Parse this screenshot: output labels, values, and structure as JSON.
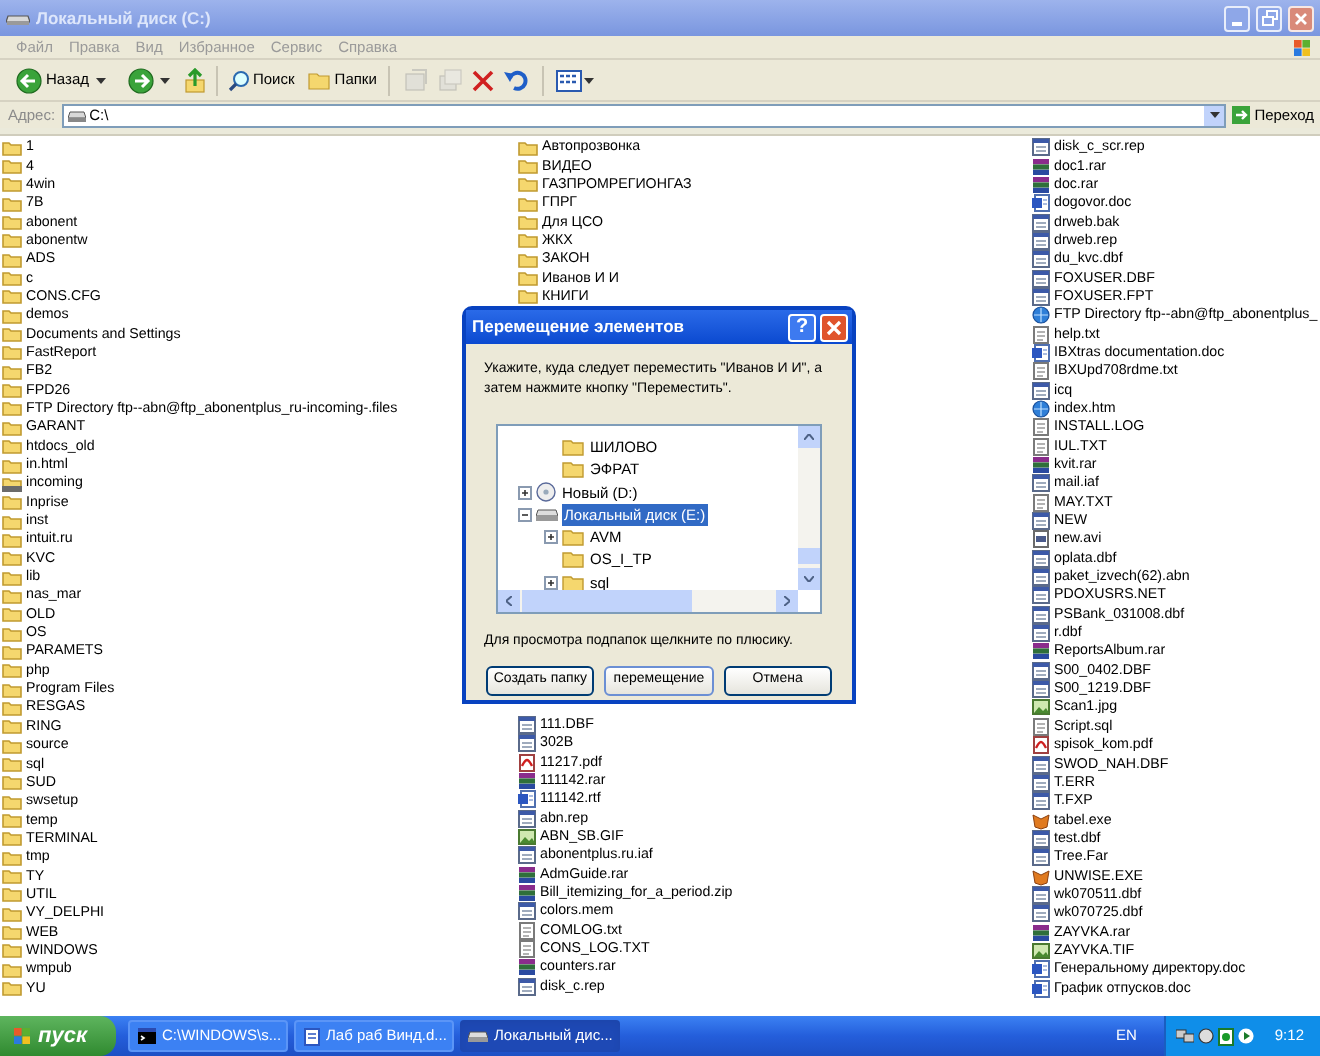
{
  "window": {
    "title": "Локальный диск (C:)"
  },
  "menu": [
    "Файл",
    "Правка",
    "Вид",
    "Избранное",
    "Сервис",
    "Справка"
  ],
  "toolbar": {
    "back_label": "Назад",
    "search_label": "Поиск",
    "folders_label": "Папки",
    "tools": [
      {
        "kind": "move",
        "disabled": true
      },
      {
        "kind": "copy",
        "disabled": true
      },
      {
        "kind": "delete",
        "disabled": false
      },
      {
        "kind": "undo",
        "disabled": false
      }
    ]
  },
  "address": {
    "label": "Адрес:",
    "value": "C:\\",
    "go_label": "Переход"
  },
  "file_columns": [
    {
      "items": [
        {
          "name": "1",
          "kind": "folder"
        },
        {
          "name": "4",
          "kind": "folder"
        },
        {
          "name": "4win",
          "kind": "folder"
        },
        {
          "name": "7B",
          "kind": "folder"
        },
        {
          "name": "abonent",
          "kind": "folder"
        },
        {
          "name": "abonentw",
          "kind": "folder"
        },
        {
          "name": "ADS",
          "kind": "folder"
        },
        {
          "name": "c",
          "kind": "folder"
        },
        {
          "name": "CONS.CFG",
          "kind": "folder"
        },
        {
          "name": "demos",
          "kind": "folder"
        },
        {
          "name": "Documents and Settings",
          "kind": "folder"
        },
        {
          "name": "FastReport",
          "kind": "folder"
        },
        {
          "name": "FB2",
          "kind": "folder"
        },
        {
          "name": "FPD26",
          "kind": "folder"
        },
        {
          "name": "FTP Directory ftp--abn@ftp_abonentplus_ru-incoming-.files",
          "kind": "folder"
        },
        {
          "name": "GARANT",
          "kind": "folder"
        },
        {
          "name": "htdocs_old",
          "kind": "folder"
        },
        {
          "name": "in.html",
          "kind": "folder"
        },
        {
          "name": "incoming",
          "kind": "shared"
        },
        {
          "name": "Inprise",
          "kind": "folder"
        },
        {
          "name": "inst",
          "kind": "folder"
        },
        {
          "name": "intuit.ru",
          "kind": "folder"
        },
        {
          "name": "KVC",
          "kind": "folder"
        },
        {
          "name": "lib",
          "kind": "folder"
        },
        {
          "name": "nas_mar",
          "kind": "folder"
        },
        {
          "name": "OLD",
          "kind": "folder"
        },
        {
          "name": "OS",
          "kind": "folder"
        },
        {
          "name": "PARAMETS",
          "kind": "folder"
        },
        {
          "name": "php",
          "kind": "folder"
        },
        {
          "name": "Program Files",
          "kind": "folder"
        },
        {
          "name": "RESGAS",
          "kind": "folder"
        },
        {
          "name": "RING",
          "kind": "folder"
        },
        {
          "name": "source",
          "kind": "folder"
        },
        {
          "name": "sql",
          "kind": "folder"
        },
        {
          "name": "SUD",
          "kind": "folder"
        },
        {
          "name": "swsetup",
          "kind": "folder"
        },
        {
          "name": "temp",
          "kind": "folder"
        },
        {
          "name": "TERMINAL",
          "kind": "folder"
        },
        {
          "name": "tmp",
          "kind": "folder"
        },
        {
          "name": "TY",
          "kind": "folder"
        },
        {
          "name": "UTIL",
          "kind": "folder"
        },
        {
          "name": "VY_DELPHI",
          "kind": "folder"
        },
        {
          "name": "WEB",
          "kind": "folder"
        },
        {
          "name": "WINDOWS",
          "kind": "folder"
        },
        {
          "name": "wmpub",
          "kind": "folder"
        },
        {
          "name": "YU",
          "kind": "folder"
        }
      ]
    },
    {
      "items": [
        {
          "name": "Автопрозвонка",
          "kind": "folder"
        },
        {
          "name": "ВИДЕО",
          "kind": "folder"
        },
        {
          "name": "ГАЗПРОМРЕГИОНГАЗ",
          "kind": "folder"
        },
        {
          "name": "ГПРГ",
          "kind": "folder"
        },
        {
          "name": "Для ЦСО",
          "kind": "folder"
        },
        {
          "name": "ЖКХ",
          "kind": "folder"
        },
        {
          "name": "ЗАКОН",
          "kind": "folder"
        },
        {
          "name": "Иванов И И",
          "kind": "folder"
        },
        {
          "name": "КНИГИ",
          "kind": "folder"
        }
      ],
      "items_after_dialog": [
        {
          "name": "111.DBF",
          "kind": "file"
        },
        {
          "name": "302B",
          "kind": "file"
        },
        {
          "name": "11217.pdf",
          "kind": "pdf"
        },
        {
          "name": "111142.rar",
          "kind": "rar"
        },
        {
          "name": "111142.rtf",
          "kind": "doc"
        },
        {
          "name": "abn.rep",
          "kind": "file"
        },
        {
          "name": "ABN_SB.GIF",
          "kind": "image"
        },
        {
          "name": "abonentplus.ru.iaf",
          "kind": "file"
        },
        {
          "name": "AdmGuide.rar",
          "kind": "rar"
        },
        {
          "name": "Bill_itemizing_for_a_period.zip",
          "kind": "rar"
        },
        {
          "name": "colors.mem",
          "kind": "file"
        },
        {
          "name": "COMLOG.txt",
          "kind": "text"
        },
        {
          "name": "CONS_LOG.TXT",
          "kind": "text"
        },
        {
          "name": "counters.rar",
          "kind": "rar"
        },
        {
          "name": "disk_c.rep",
          "kind": "file"
        }
      ]
    },
    {
      "items": [
        {
          "name": "disk_c_scr.rep",
          "kind": "file"
        },
        {
          "name": "doc1.rar",
          "kind": "rar"
        },
        {
          "name": "doc.rar",
          "kind": "rar"
        },
        {
          "name": "dogovor.doc",
          "kind": "doc"
        },
        {
          "name": "drweb.bak",
          "kind": "file"
        },
        {
          "name": "drweb.rep",
          "kind": "file"
        },
        {
          "name": "du_kvc.dbf",
          "kind": "file"
        },
        {
          "name": "FOXUSER.DBF",
          "kind": "file"
        },
        {
          "name": "FOXUSER.FPT",
          "kind": "file"
        },
        {
          "name": "FTP Directory ftp--abn@ftp_abonentplus_",
          "kind": "web"
        },
        {
          "name": "help.txt",
          "kind": "text"
        },
        {
          "name": "IBXtras documentation.doc",
          "kind": "doc"
        },
        {
          "name": "IBXUpd708rdme.txt",
          "kind": "text"
        },
        {
          "name": "icq",
          "kind": "file"
        },
        {
          "name": "index.htm",
          "kind": "web"
        },
        {
          "name": "INSTALL.LOG",
          "kind": "text"
        },
        {
          "name": "IUL.TXT",
          "kind": "text"
        },
        {
          "name": "kvit.rar",
          "kind": "rar"
        },
        {
          "name": "mail.iaf",
          "kind": "file"
        },
        {
          "name": "MAY.TXT",
          "kind": "text"
        },
        {
          "name": "NEW",
          "kind": "file"
        },
        {
          "name": "new.avi",
          "kind": "video"
        },
        {
          "name": "oplata.dbf",
          "kind": "file"
        },
        {
          "name": "paket_izvech(62).abn",
          "kind": "file"
        },
        {
          "name": "PDOXUSRS.NET",
          "kind": "file"
        },
        {
          "name": "PSBank_031008.dbf",
          "kind": "file"
        },
        {
          "name": "r.dbf",
          "kind": "file"
        },
        {
          "name": "ReportsAlbum.rar",
          "kind": "rar"
        },
        {
          "name": "S00_0402.DBF",
          "kind": "file"
        },
        {
          "name": "S00_1219.DBF",
          "kind": "file"
        },
        {
          "name": "Scan1.jpg",
          "kind": "image"
        },
        {
          "name": "Script.sql",
          "kind": "text"
        },
        {
          "name": "spisok_kom.pdf",
          "kind": "pdf"
        },
        {
          "name": "SWOD_NAH.DBF",
          "kind": "file"
        },
        {
          "name": "T.ERR",
          "kind": "file"
        },
        {
          "name": "T.FXP",
          "kind": "file"
        },
        {
          "name": "tabel.exe",
          "kind": "exe"
        },
        {
          "name": "test.dbf",
          "kind": "file"
        },
        {
          "name": "Tree.Far",
          "kind": "file"
        },
        {
          "name": "UNWISE.EXE",
          "kind": "exe"
        },
        {
          "name": "wk070511.dbf",
          "kind": "file"
        },
        {
          "name": "wk070725.dbf",
          "kind": "file"
        },
        {
          "name": "ZAYVKA.rar",
          "kind": "rar"
        },
        {
          "name": "ZAYVKA.TIF",
          "kind": "image"
        },
        {
          "name": "Генеральному директору.doc",
          "kind": "doc"
        },
        {
          "name": "График отпусков.doc",
          "kind": "doc"
        }
      ]
    }
  ],
  "dialog": {
    "title": "Перемещение элементов",
    "help_label": "?",
    "instruction": "Укажите, куда следует переместить \"Иванов И И\", а затем нажмите кнопку \"Переместить\".",
    "tree": {
      "scrolled_branch": [
        {
          "label": "ШИЛОВО",
          "kind": "folder",
          "expandable": false,
          "selected": false
        },
        {
          "label": "ЭФРАТ",
          "kind": "folder",
          "expandable": false,
          "selected": false
        }
      ],
      "nodes": [
        {
          "label": "Новый (D:)",
          "kind": "cd",
          "expandable": true,
          "expanded": false,
          "selected": false
        },
        {
          "label": "Локальный диск (E:)",
          "kind": "drive",
          "expandable": true,
          "expanded": true,
          "selected": true,
          "children": [
            {
              "label": "AVM",
              "kind": "folder",
              "expandable": true,
              "expanded": false,
              "selected": false
            },
            {
              "label": "OS_I_TP",
              "kind": "folder",
              "expandable": false,
              "selected": false
            },
            {
              "label": "sql",
              "kind": "folder",
              "expandable": true,
              "expanded": false,
              "selected": false
            }
          ]
        }
      ]
    },
    "hint": "Для просмотра подпапок щелкните по плюсику.",
    "buttons": [
      {
        "label": "Создать папку",
        "default": false
      },
      {
        "label": "перемещение",
        "default": true
      },
      {
        "label": "Отмена",
        "default": false
      }
    ]
  },
  "taskbar": {
    "start_label": "пуск",
    "tasks": [
      {
        "label": "C:\\WINDOWS\\s...",
        "kind": "console",
        "selected": false
      },
      {
        "label": "Лаб раб Винд.d...",
        "kind": "document",
        "selected": false
      },
      {
        "label": "Локальный дис...",
        "kind": "drive",
        "selected": true
      }
    ],
    "language": "EN",
    "clock": "9:12"
  }
}
